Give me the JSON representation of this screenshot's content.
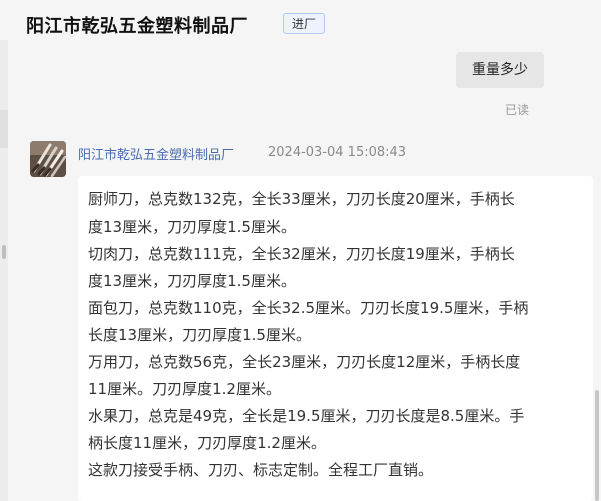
{
  "header": {
    "title": "阳江市乾弘五金塑料制品厂",
    "badge": "进厂"
  },
  "messages": {
    "outgoing": {
      "text": "重量多少",
      "status": "已读"
    },
    "incoming": {
      "sender": "阳江市乾弘五金塑料制品厂",
      "timestamp": "2024-03-04 15:08:43",
      "lines": [
        "厨师刀，总克数132克，全长33厘米，刀刃长度20厘米，手柄长",
        "度13厘米，刀刃厚度1.5厘米。",
        "切肉刀，总克数111克，全长32厘米，刀刃长度19厘米，手柄长",
        "度13厘米，刀刃厚度1.5厘米。",
        "面包刀，总克数110克，全长32.5厘米。刀刃长度19.5厘米，手柄",
        "长度13厘米，刀刃厚度1.5厘米。",
        "万用刀，总克数56克，全长23厘米，刀刃长度12厘米，手柄长度",
        "11厘米。刀刃厚度1.2厘米。",
        "水果刀，总克是49克，全长是19.5厘米，刀刃长度是8.5厘米。手",
        "柄长度11厘米，刀刃厚度1.2厘米。",
        "这款刀接受手柄、刀刃、标志定制。全程工厂直销。"
      ]
    }
  }
}
